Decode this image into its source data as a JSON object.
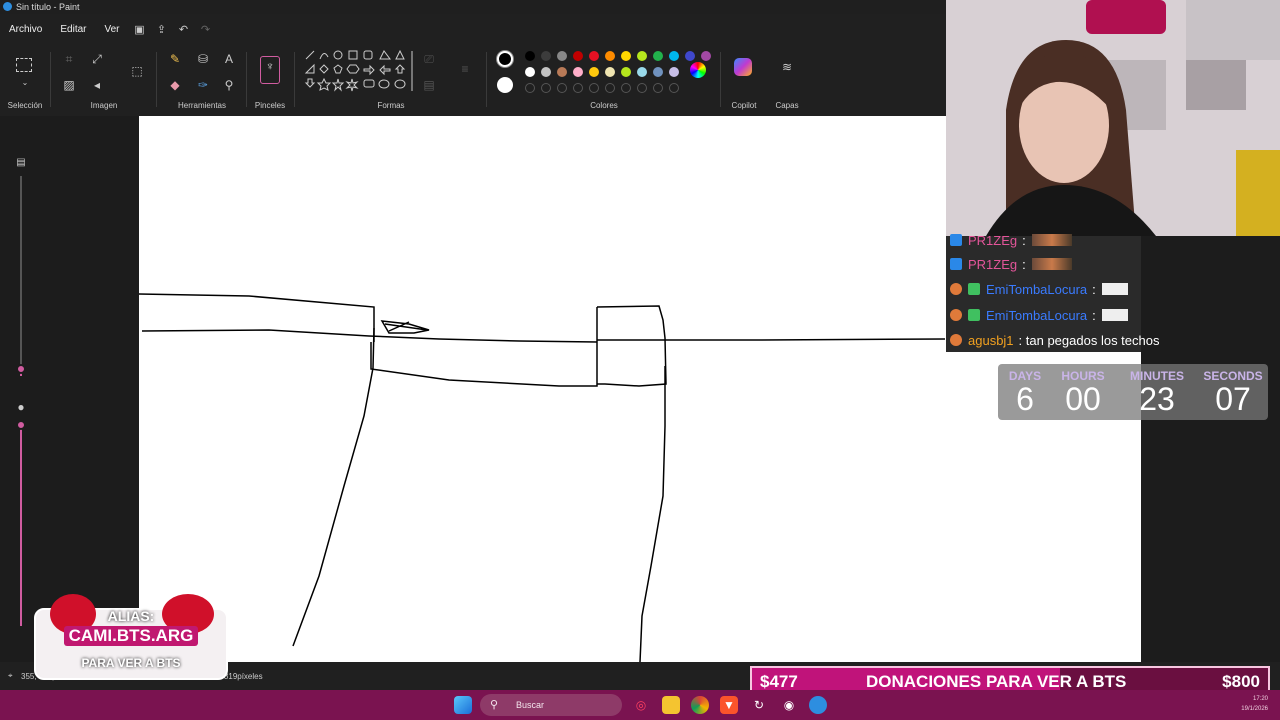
{
  "window": {
    "title": "Sin título - Paint"
  },
  "menu": {
    "items": [
      "Archivo",
      "Editar",
      "Ver"
    ]
  },
  "ribbon": {
    "groups": {
      "seleccion": "Selección",
      "imagen": "Imagen",
      "herramientas": "Herramientas",
      "pinceles": "Pinceles",
      "formas": "Formas",
      "colores": "Colores",
      "copilot": "Copilot",
      "capas": "Capas"
    },
    "palette_row1": [
      "#000000",
      "#3c3c3c",
      "#888888",
      "#c00000",
      "#e81123",
      "#ff8c00",
      "#ffd700",
      "#b5e61d",
      "#22b14c",
      "#00b7eb",
      "#3f48cc",
      "#a349a4"
    ],
    "palette_row2": [
      "#ffffff",
      "#c3c3c3",
      "#b97a57",
      "#ffaec9",
      "#ffc90e",
      "#efe4b0",
      "#b5e61d",
      "#99d9ea",
      "#7092be",
      "#c8bfe7"
    ],
    "primary_color": "#000000",
    "secondary_color": "#ffffff"
  },
  "status": {
    "cursor_position": "355, 320píxeles",
    "canvas_size": "1503 × 819píxeles"
  },
  "taskbar": {
    "search_placeholder": "Buscar",
    "time": "17:20",
    "date": "19/1/2026"
  },
  "chat": {
    "messages": [
      {
        "user": "PR1ZEg",
        "text": ":",
        "color": "#e4559a"
      },
      {
        "user": "PR1ZEg",
        "text": ":",
        "color": "#e4559a"
      },
      {
        "user": "EmiTombaLocura",
        "text": ":",
        "color": "#3a7bff"
      },
      {
        "user": "EmiTombaLocura",
        "text": ":",
        "color": "#3a7bff"
      },
      {
        "user": "agusbj1",
        "text": ": tan pegados los techos",
        "color": "#f0a020"
      }
    ]
  },
  "countdown": {
    "labels": [
      "DAYS",
      "HOURS",
      "MINUTES",
      "SECONDS"
    ],
    "values": [
      "6",
      "00",
      "23",
      "07"
    ]
  },
  "donations": {
    "current": "$477",
    "title": "DONACIONES PARA VER A BTS",
    "goal": "$800",
    "progress": 0.596
  },
  "alias_badge": {
    "alias": "ALIAS:",
    "handle": "CAMI.BTS.ARG",
    "subtitle": "PARA VER A BTS"
  }
}
